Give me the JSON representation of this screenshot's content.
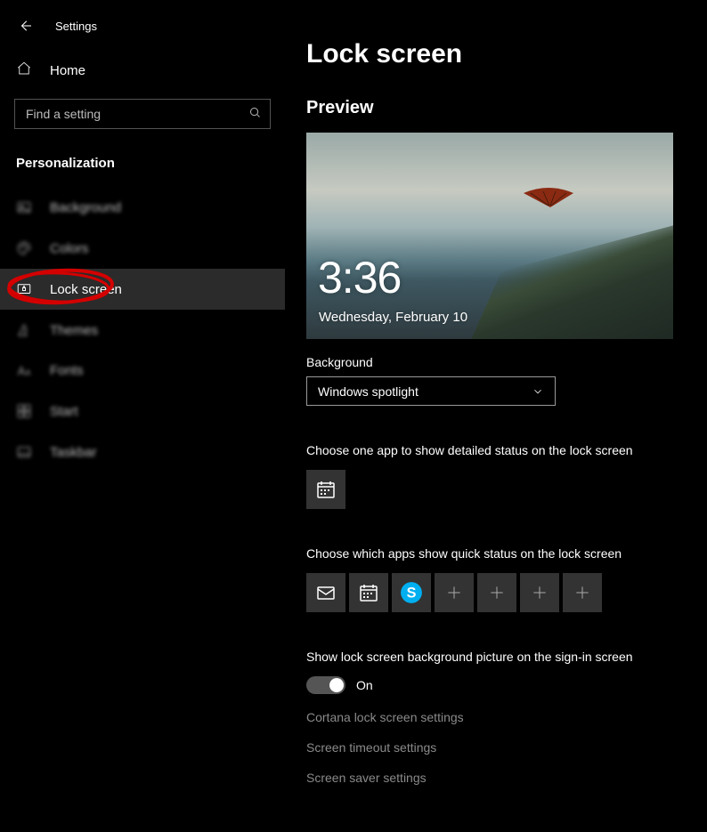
{
  "window": {
    "title": "Settings"
  },
  "sidebar": {
    "home": "Home",
    "search_placeholder": "Find a setting",
    "section": "Personalization",
    "items": [
      {
        "label": "Background"
      },
      {
        "label": "Colors"
      },
      {
        "label": "Lock screen"
      },
      {
        "label": "Themes"
      },
      {
        "label": "Fonts"
      },
      {
        "label": "Start"
      },
      {
        "label": "Taskbar"
      }
    ]
  },
  "page": {
    "title": "Lock screen",
    "preview_heading": "Preview",
    "preview_time": "3:36",
    "preview_date": "Wednesday, February 10",
    "bg_label": "Background",
    "bg_value": "Windows spotlight",
    "detailed_desc": "Choose one app to show detailed status on the lock screen",
    "quick_desc": "Choose which apps show quick status on the lock screen",
    "signin_desc": "Show lock screen background picture on the sign-in screen",
    "signin_toggle": "On",
    "links": [
      "Cortana lock screen settings",
      "Screen timeout settings",
      "Screen saver settings"
    ]
  }
}
